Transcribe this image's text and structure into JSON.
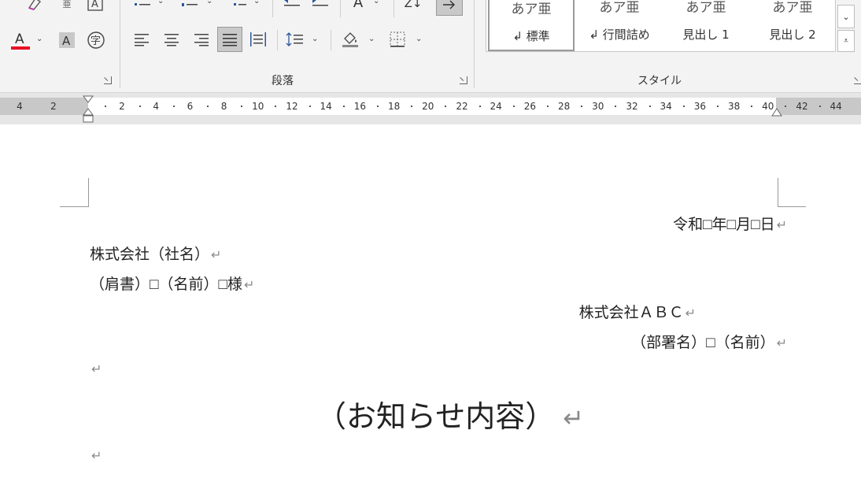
{
  "ribbon": {
    "paragraph_group_label": "段落",
    "styles_group_label": "スタイル",
    "styles": [
      {
        "preview": "あア亜",
        "name": "↲ 標準",
        "selected": true
      },
      {
        "preview": "あア亜",
        "name": "↲ 行間詰め",
        "selected": false
      },
      {
        "preview": "あア亜",
        "name": "見出し 1",
        "selected": false
      },
      {
        "preview": "あア亜",
        "name": "見出し 2",
        "selected": false
      }
    ],
    "sort_label": "Z↓",
    "colors": {
      "font_color_bar": "#e81123",
      "accent_blue": "#2b579a"
    }
  },
  "ruler": {
    "left_labels": [
      "4",
      "2"
    ],
    "labels": [
      "2",
      "4",
      "6",
      "8",
      "10",
      "12",
      "14",
      "16",
      "18",
      "20",
      "22",
      "24",
      "26",
      "28",
      "30",
      "32",
      "34",
      "36",
      "38",
      "40",
      "42",
      "44"
    ]
  },
  "document": {
    "date_line": "令和□年□月□日",
    "recipient_company": "株式会社（社名）",
    "recipient_person": "（肩書）□（名前）□様",
    "sender_company": "株式会社ＡＢＣ",
    "sender_person": "（部署名）□（名前）",
    "title": "（お知らせ内容）",
    "paragraph_mark": "↵"
  }
}
